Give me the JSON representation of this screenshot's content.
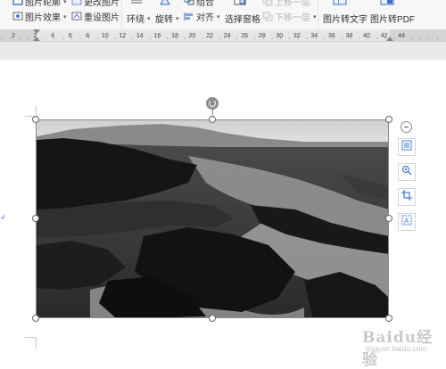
{
  "ribbon": {
    "picture_outline_label": "图片轮廓",
    "picture_effect_label": "图片效果",
    "change_picture_label": "更改图片",
    "reset_picture_label": "重设图片",
    "wrap_label": "环绕",
    "rotate_label": "旋转",
    "combine_label": "组合",
    "align_label": "对齐",
    "selection_pane_label": "选择窗格",
    "bring_forward_label": "上移一层",
    "send_backward_label": "下移一层",
    "picture_to_text_label": "图片转文字",
    "picture_to_pdf_label": "图片转PDF"
  },
  "ruler": {
    "ticks": [
      "2",
      "2",
      "4",
      "6",
      "8",
      "10",
      "12",
      "14",
      "16",
      "18",
      "20",
      "22",
      "24",
      "26",
      "28",
      "30",
      "32",
      "34",
      "36",
      "38",
      "40",
      "42",
      "44"
    ]
  },
  "document": {
    "picture": {
      "description_color_sky": "#d9d9d9",
      "description_color_sea": "#3a3a3a"
    },
    "paragraph_mark": "↲"
  },
  "float_toolbar": {
    "items": [
      "layout-options-icon",
      "zoom-in-icon",
      "crop-icon",
      "picture-text-icon"
    ]
  },
  "watermark": {
    "logo": "Baidu经验",
    "url": "jingyan.baidu.com"
  }
}
